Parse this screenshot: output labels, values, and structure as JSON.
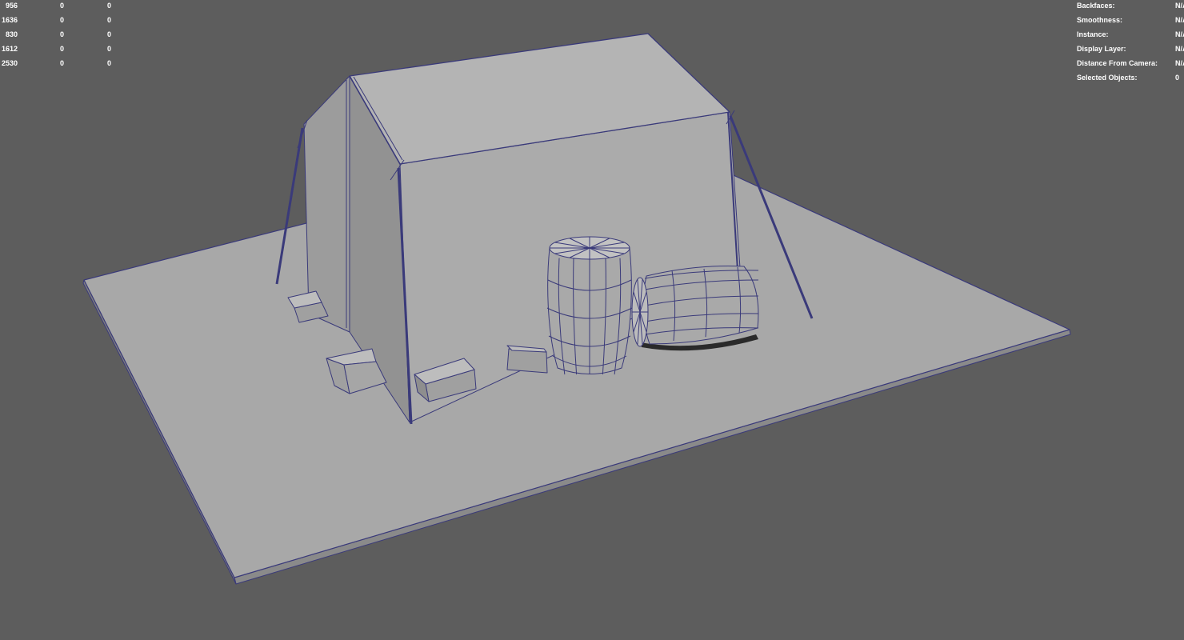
{
  "viewport": {
    "background": "#5d5d5d",
    "wire_color": "#3a3a7a",
    "surface_color": "#a8a8a8",
    "shade_dark": "#8c8c8c",
    "shade_mid": "#9a9a9a",
    "shade_light": "#b2b2b2"
  },
  "heads_up_left": {
    "rows": [
      {
        "count": "956",
        "c2": "0",
        "c3": "0"
      },
      {
        "count": "1636",
        "c2": "0",
        "c3": "0"
      },
      {
        "count": "830",
        "c2": "0",
        "c3": "0"
      },
      {
        "count": "1612",
        "c2": "0",
        "c3": "0"
      },
      {
        "count": "2530",
        "c2": "0",
        "c3": "0"
      }
    ]
  },
  "heads_up_right": {
    "rows": [
      {
        "label": "Backfaces:",
        "value": "N/A"
      },
      {
        "label": "Smoothness:",
        "value": "N/A"
      },
      {
        "label": "Instance:",
        "value": "N/A"
      },
      {
        "label": "Display Layer:",
        "value": "N/A"
      },
      {
        "label": "Distance From Camera:",
        "value": "N/A"
      },
      {
        "label": "Selected Objects:",
        "value": "0"
      }
    ]
  }
}
